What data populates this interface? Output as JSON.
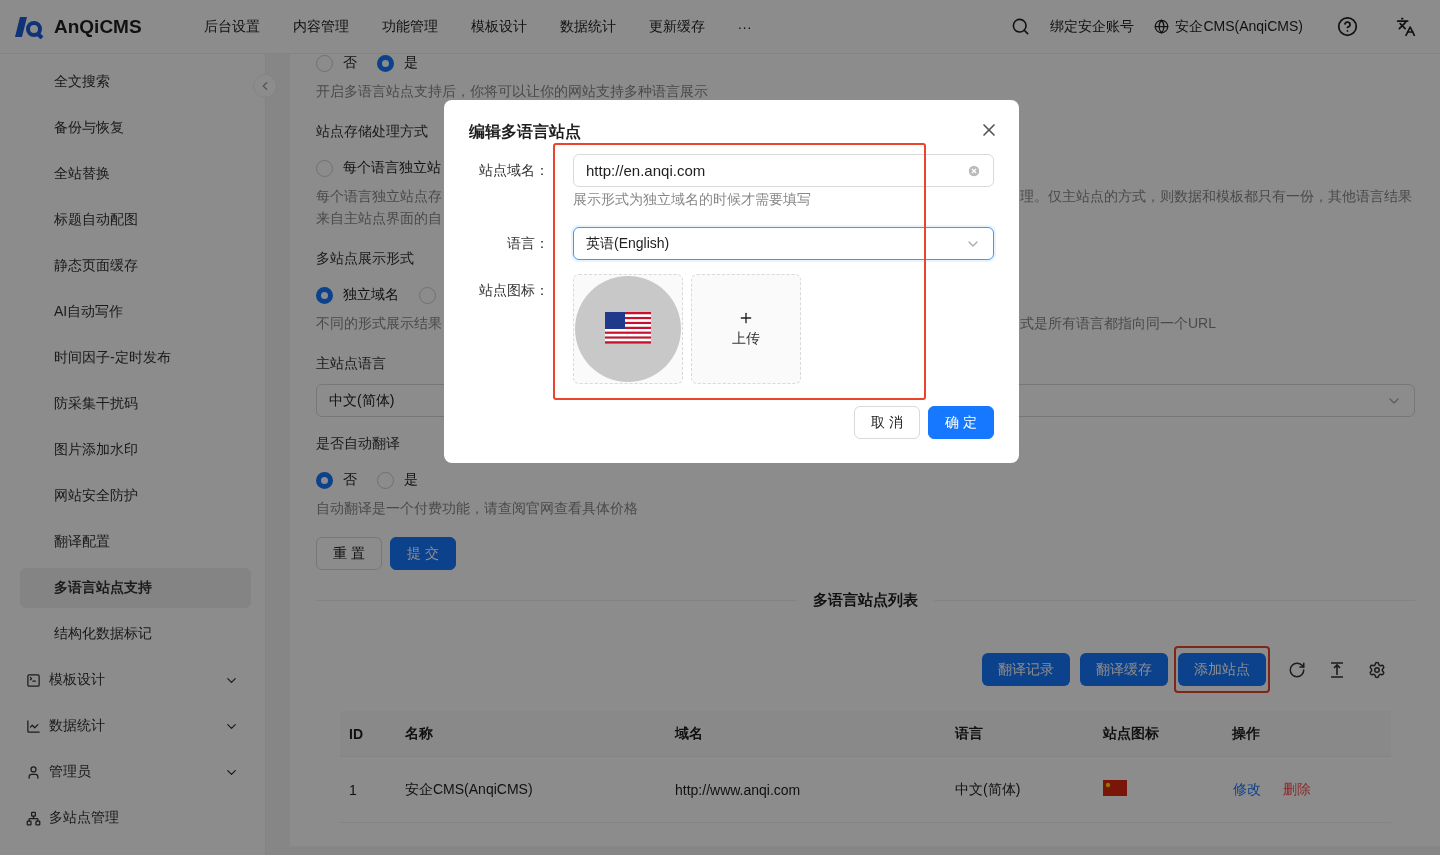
{
  "header": {
    "brand": "AnQiCMS",
    "menu": [
      "后台设置",
      "内容管理",
      "功能管理",
      "模板设计",
      "数据统计",
      "更新缓存"
    ],
    "more": "···",
    "account_link": "绑定安企账号",
    "site_switch": "安企CMS(AnqiCMS)"
  },
  "sidebar": {
    "items": [
      {
        "kind": "item",
        "label": "全文搜索",
        "selected": false
      },
      {
        "kind": "item",
        "label": "备份与恢复",
        "selected": false
      },
      {
        "kind": "item",
        "label": "全站替换",
        "selected": false
      },
      {
        "kind": "item",
        "label": "标题自动配图",
        "selected": false
      },
      {
        "kind": "item",
        "label": "静态页面缓存",
        "selected": false
      },
      {
        "kind": "item",
        "label": "AI自动写作",
        "selected": false
      },
      {
        "kind": "item",
        "label": "时间因子-定时发布",
        "selected": false
      },
      {
        "kind": "item",
        "label": "防采集干扰码",
        "selected": false
      },
      {
        "kind": "item",
        "label": "图片添加水印",
        "selected": false
      },
      {
        "kind": "item",
        "label": "网站安全防护",
        "selected": false
      },
      {
        "kind": "item",
        "label": "翻译配置",
        "selected": false
      },
      {
        "kind": "item",
        "label": "多语言站点支持",
        "selected": true
      },
      {
        "kind": "item",
        "label": "结构化数据标记",
        "selected": false
      },
      {
        "kind": "group",
        "label": "模板设计",
        "expanded": false
      },
      {
        "kind": "group",
        "label": "数据统计",
        "expanded": false
      },
      {
        "kind": "group",
        "label": "管理员",
        "expanded": false
      },
      {
        "kind": "link",
        "label": "多站点管理"
      }
    ]
  },
  "form": {
    "rows": [
      {
        "kind": "radio",
        "options": [
          {
            "label": "否",
            "selected": false
          },
          {
            "label": "是",
            "selected": true
          }
        ]
      },
      {
        "kind": "help",
        "text": "开启多语言站点支持后，你将可以让你的网站支持多种语言展示"
      },
      {
        "kind": "label",
        "text": "站点存储处理方式"
      },
      {
        "kind": "radio",
        "options": [
          {
            "label": "每个语言独立站",
            "selected": false
          }
        ]
      },
      {
        "kind": "help",
        "text": "每个语言独立站点存",
        "text_right": "理。仅主站点的方式，则数据和模板都只有一份，其他语言结果"
      },
      {
        "kind": "help",
        "text": "来自主站点界面的自"
      },
      {
        "kind": "label",
        "text": "多站点展示形式"
      },
      {
        "kind": "radio",
        "options": [
          {
            "label": "独立域名",
            "selected": true
          },
          {
            "selected": false
          }
        ]
      },
      {
        "kind": "help",
        "text": "不同的形式展示结果",
        "text_right": "式是所有语言都指向同一个URL"
      },
      {
        "kind": "label",
        "text": "主站点语言"
      },
      {
        "kind": "select",
        "value": "中文(简体)"
      },
      {
        "kind": "label",
        "text": "是否自动翻译"
      },
      {
        "kind": "radio",
        "options": [
          {
            "label": "否",
            "selected": true
          },
          {
            "label": "是",
            "selected": false
          }
        ]
      },
      {
        "kind": "help",
        "text": "自动翻译是一个付费功能，请查阅官网查看具体价格"
      },
      {
        "kind": "buttons",
        "buttons": [
          {
            "label": "重 置",
            "primary": false
          },
          {
            "label": "提 交",
            "primary": true
          }
        ]
      }
    ]
  },
  "site_list": {
    "title": "多语言站点列表",
    "toolbar": [
      {
        "label": "翻译记录",
        "highlighted": false
      },
      {
        "label": "翻译缓存",
        "highlighted": false
      },
      {
        "label": "添加站点",
        "highlighted": true
      }
    ],
    "table": {
      "columns": [
        "ID",
        "名称",
        "域名",
        "语言",
        "站点图标",
        "操作"
      ],
      "rows": [
        {
          "cells": [
            "1",
            "安企CMS(AnqiCMS)",
            "http://www.anqi.com",
            "中文(简体)"
          ],
          "actions": [
            {
              "label": "修改",
              "kind": "edit"
            },
            {
              "label": "删除",
              "kind": "delete"
            }
          ]
        }
      ]
    }
  },
  "modal": {
    "title": "编辑多语言站点",
    "highlighted": true,
    "fields": [
      {
        "kind": "input",
        "label": "站点域名：",
        "value": "http://en.anqi.com",
        "hint": "展示形式为独立域名的时候才需要填写"
      },
      {
        "kind": "select",
        "label": "语言：",
        "value": "英语(English)",
        "focused": true
      },
      {
        "kind": "upload",
        "label": "站点图标：",
        "upload_text": "上传"
      }
    ],
    "buttons": [
      {
        "label": "取 消",
        "primary": false
      },
      {
        "label": "确 定",
        "primary": true
      }
    ]
  }
}
